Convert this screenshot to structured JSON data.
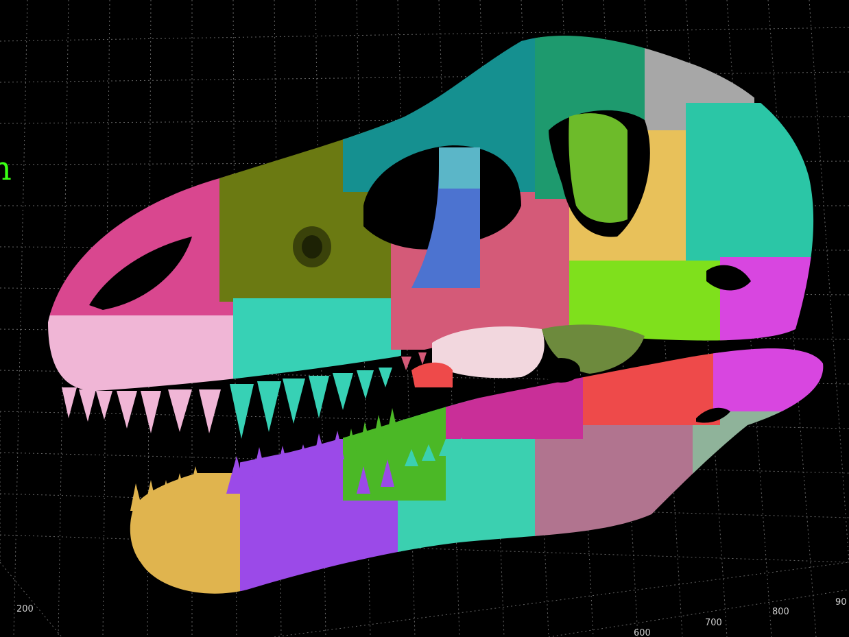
{
  "viewer": {
    "partial_label": "n",
    "label_color": "#39ff14",
    "background": "#000000",
    "grid_color": "#8a8a8a"
  },
  "axis_ticks": {
    "left": [
      "200"
    ],
    "bottom": [
      "600",
      "700",
      "800",
      "90"
    ]
  },
  "model": {
    "subject": "theropod-skull-segmented",
    "segment_colors": {
      "premaxilla": "#f0b6d6",
      "nasal_front": "#d9478f",
      "maxilla_upper": "#6b7a12",
      "maxilla_lower": "#37d1b5",
      "lacrimal": "#159090",
      "jugal": "#d45a78",
      "palatine": "#4c73d0",
      "quadrate": "#e8c15a",
      "postorbital": "#7fe01c",
      "frontal": "#a7a7a7",
      "squamosal": "#2bc6a6",
      "quadratojugal": "#d846e0",
      "dentary_front": "#e0b44e",
      "dentary": "#9b4ae8",
      "splenial": "#3bd0b0",
      "surangular": "#b1748f",
      "angular": "#ee4a4a",
      "articular": "#c92f98",
      "coronoid": "#4bb826"
    }
  }
}
